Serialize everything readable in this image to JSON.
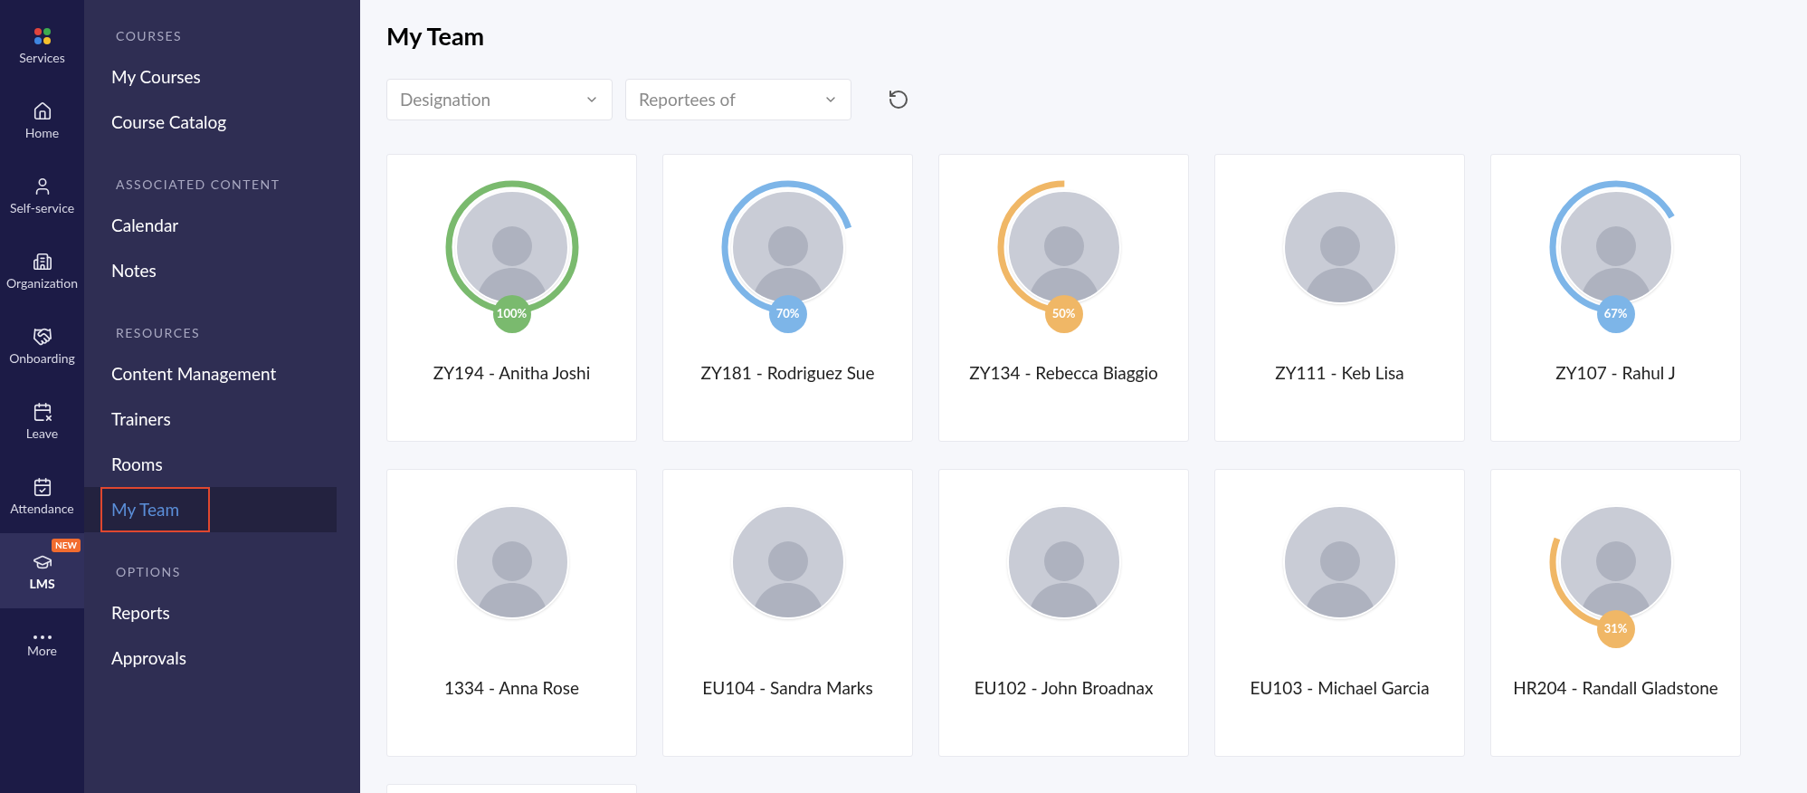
{
  "rail": [
    {
      "label": "Services",
      "selected": false
    },
    {
      "label": "Home",
      "selected": false
    },
    {
      "label": "Self-service",
      "selected": false
    },
    {
      "label": "Organization",
      "selected": false
    },
    {
      "label": "Onboarding",
      "selected": false
    },
    {
      "label": "Leave",
      "selected": false
    },
    {
      "label": "Attendance",
      "selected": false
    },
    {
      "label": "LMS",
      "selected": true,
      "badge": "NEW"
    },
    {
      "label": "More",
      "selected": false
    }
  ],
  "sidebar": {
    "sections": [
      {
        "heading": "COURSES",
        "items": [
          {
            "label": "My Courses",
            "selected": false,
            "outlined": false
          },
          {
            "label": "Course Catalog",
            "selected": false,
            "outlined": false
          }
        ]
      },
      {
        "heading": "ASSOCIATED CONTENT",
        "items": [
          {
            "label": "Calendar",
            "selected": false,
            "outlined": false
          },
          {
            "label": "Notes",
            "selected": false,
            "outlined": false
          }
        ]
      },
      {
        "heading": "RESOURCES",
        "items": [
          {
            "label": "Content Management",
            "selected": false,
            "outlined": false
          },
          {
            "label": "Trainers",
            "selected": false,
            "outlined": false
          },
          {
            "label": "Rooms",
            "selected": false,
            "outlined": false
          },
          {
            "label": "My Team",
            "selected": true,
            "outlined": true
          }
        ]
      },
      {
        "heading": "OPTIONS",
        "items": [
          {
            "label": "Reports",
            "selected": false,
            "outlined": false
          },
          {
            "label": "Approvals",
            "selected": false,
            "outlined": false
          }
        ]
      }
    ]
  },
  "page": {
    "title": "My Team"
  },
  "filters": [
    {
      "placeholder": "Designation"
    },
    {
      "placeholder": "Reportees of"
    }
  ],
  "members": [
    {
      "name": "ZY194 - Anitha Joshi",
      "progress": {
        "level": 1,
        "label": "100%",
        "color": "#7aba6e"
      }
    },
    {
      "name": "ZY181 - Rodriguez Sue",
      "progress": {
        "level": 0.7,
        "label": "70%",
        "color": "#7db5e8"
      }
    },
    {
      "name": "ZY134 - Rebecca Biaggio",
      "progress": {
        "level": 0.5,
        "label": "50%",
        "color": "#f0b766"
      }
    },
    {
      "name": "ZY111 - Keb Lisa"
    },
    {
      "name": "ZY107 - Rahul J",
      "progress": {
        "level": 0.67,
        "label": "67%",
        "color": "#7db5e8"
      }
    },
    {
      "name": "1334 - Anna Rose"
    },
    {
      "name": "EU104 - Sandra Marks"
    },
    {
      "name": "EU102 - John Broadnax"
    },
    {
      "name": "EU103 - Michael Garcia"
    },
    {
      "name": "HR204 - Randall Gladstone",
      "progress": {
        "level": 0.31,
        "label": "31%",
        "color": "#f0b766"
      }
    }
  ]
}
